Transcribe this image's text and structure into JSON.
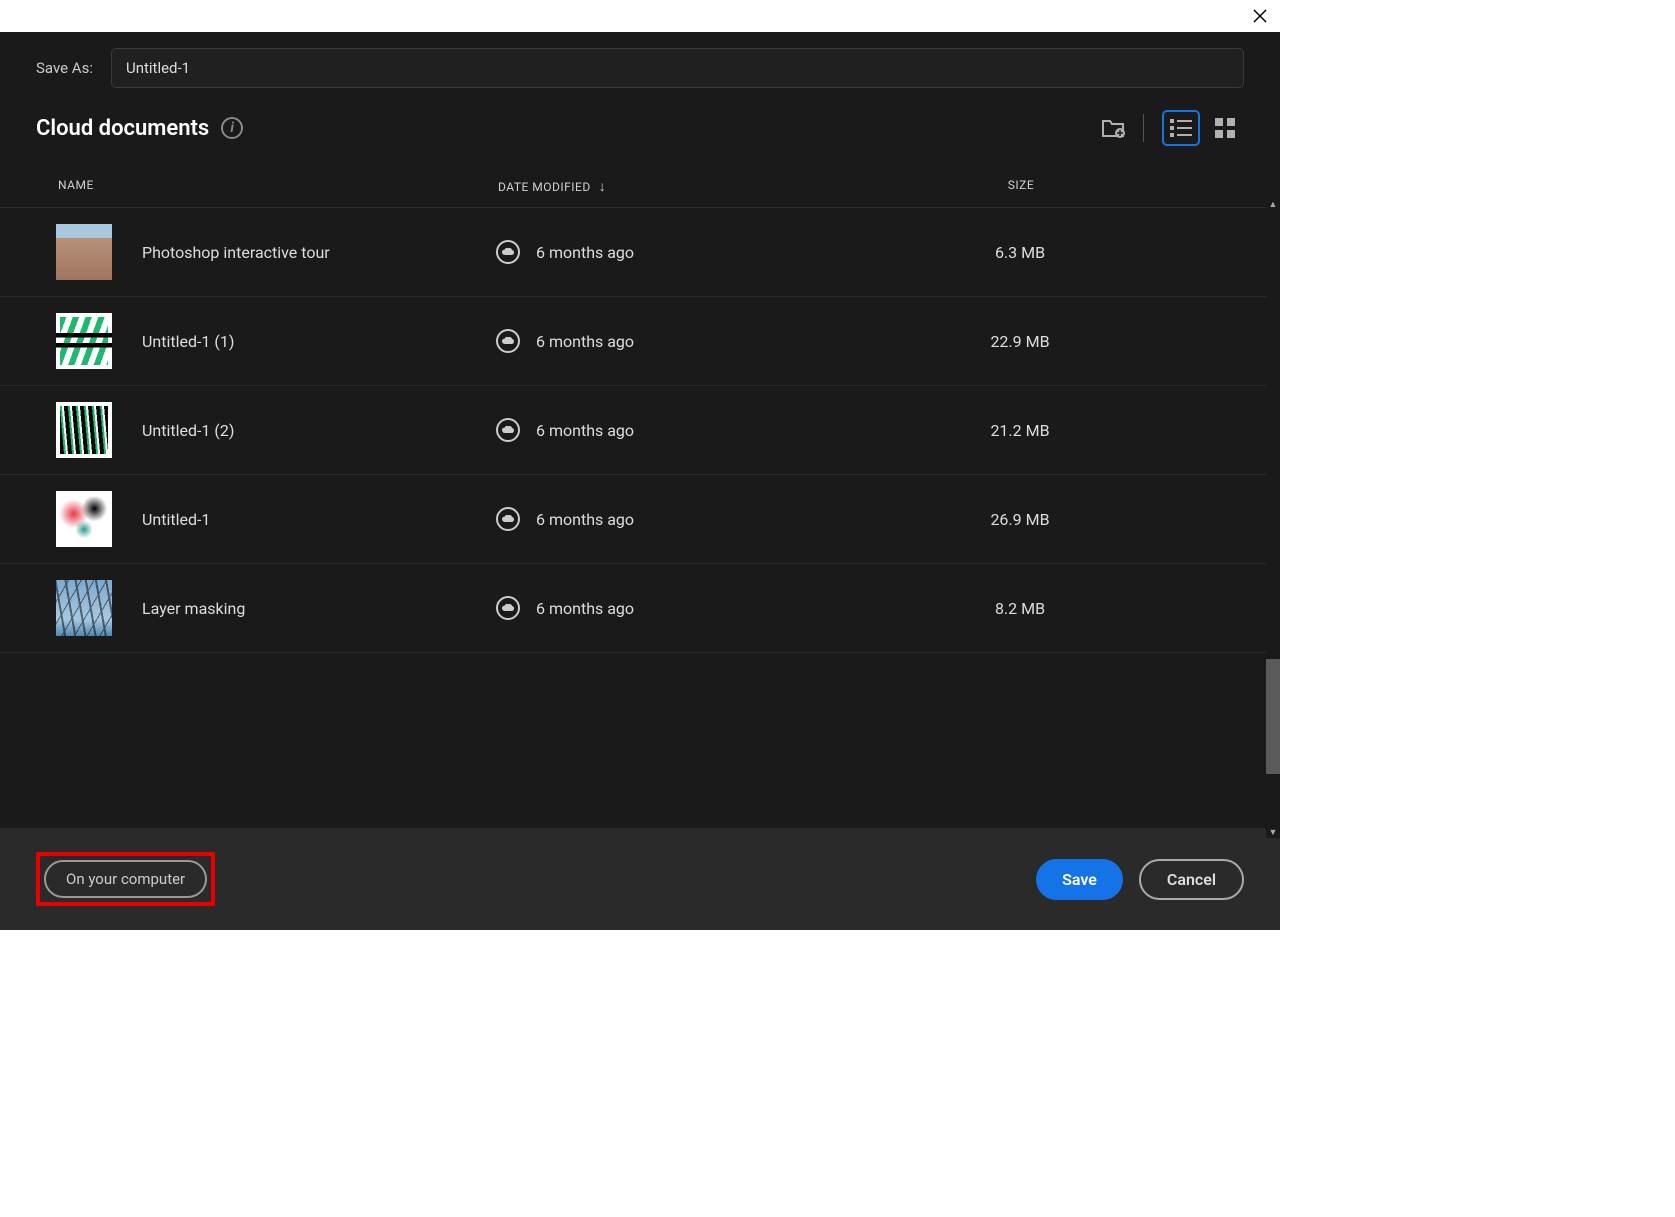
{
  "header": {
    "save_as_label": "Save As:",
    "filename_value": "Untitled-1",
    "cloud_title": "Cloud documents"
  },
  "columns": {
    "name": "NAME",
    "date": "DATE MODIFIED",
    "size": "SIZE"
  },
  "files": [
    {
      "name": "Photoshop interactive tour",
      "date": "6 months ago",
      "size": "6.3 MB",
      "thumb_class": "thumb-landscape"
    },
    {
      "name": "Untitled-1 (1)",
      "date": "6 months ago",
      "size": "22.9 MB",
      "thumb_class": "thumb-scribble-green"
    },
    {
      "name": "Untitled-1 (2)",
      "date": "6 months ago",
      "size": "21.2 MB",
      "thumb_class": "thumb-scribble-dark"
    },
    {
      "name": "Untitled-1",
      "date": "6 months ago",
      "size": "26.9 MB",
      "thumb_class": "thumb-paint"
    },
    {
      "name": "Layer masking",
      "date": "6 months ago",
      "size": "8.2 MB",
      "thumb_class": "thumb-sky"
    }
  ],
  "footer": {
    "local_label": "On your computer",
    "save_label": "Save",
    "cancel_label": "Cancel"
  }
}
